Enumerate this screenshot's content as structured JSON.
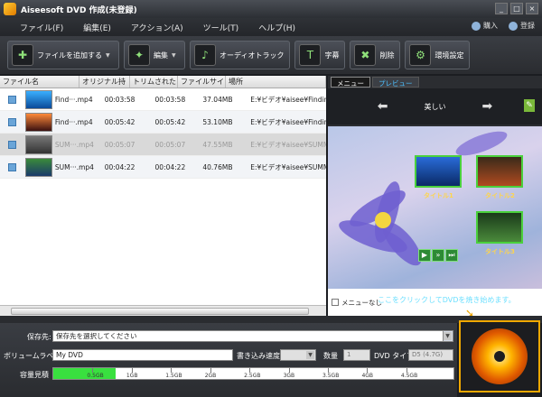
{
  "window": {
    "title": "Aiseesoft DVD 作成(未登録)",
    "buttons": [
      "_",
      "□",
      "×"
    ]
  },
  "menubar": {
    "items": [
      "ファイル(F)",
      "編集(E)",
      "アクション(A)",
      "ツール(T)",
      "ヘルプ(H)"
    ],
    "right": [
      "購入",
      "登録"
    ]
  },
  "toolbar": {
    "buttons": [
      {
        "label": "ファイルを追加する",
        "icon": "add-file-icon"
      },
      {
        "label": "編集",
        "icon": "magic-wand-icon"
      },
      {
        "label": "オーディオトラック",
        "icon": "audio-track-icon"
      },
      {
        "label": "字幕",
        "icon": "subtitle-icon"
      },
      {
        "label": "削除",
        "icon": "delete-icon"
      },
      {
        "label": "環境設定",
        "icon": "gear-icon"
      }
    ]
  },
  "filelist": {
    "columns": [
      "ファイル名",
      "オリジナル持",
      "トリムされた",
      "ファイルサイ",
      "場所"
    ],
    "rows": [
      {
        "name": "Find···.mp4",
        "orig": "00:03:58",
        "trim": "00:03:58",
        "size": "37.04MB",
        "path": "E:¥ビデオ¥aisee¥Finding···",
        "disabled": false
      },
      {
        "name": "Find···.mp4",
        "orig": "00:05:42",
        "trim": "00:05:42",
        "size": "53.10MB",
        "path": "E:¥ビデオ¥aisee¥Finding···",
        "disabled": false
      },
      {
        "name": "SUM···.mp4",
        "orig": "00:05:07",
        "trim": "00:05:07",
        "size": "47.55MB",
        "path": "E:¥ビデオ¥aisee¥SUMM···",
        "disabled": true
      },
      {
        "name": "SUM···.mp4",
        "orig": "00:04:22",
        "trim": "00:04:22",
        "size": "40.76MB",
        "path": "E:¥ビデオ¥aisee¥SUMM···",
        "disabled": false
      }
    ]
  },
  "preview": {
    "tabs": [
      "メニュー",
      "プレビュー"
    ],
    "template_name": "美しい",
    "menu_titles": [
      "タイトル1",
      "タイトル2",
      "タイトル3"
    ],
    "no_menu_label": "メニューなし"
  },
  "settings": {
    "save_label": "保存先:",
    "save_placeholder": "保存先を選択してください",
    "volume_label": "ボリュームラベル",
    "volume_value": "My DVD",
    "speed_label": "書き込み速度",
    "count_label": "数量",
    "count_value": "1",
    "dvd_type_label": "DVD タイプ",
    "dvd_type_value": "D5 (4.7G)",
    "capacity_label": "容量見積",
    "capacity_ticks": [
      "0.5GB",
      "1GB",
      "1.5GB",
      "2GB",
      "2.5GB",
      "3GB",
      "3.5GB",
      "4GB",
      "4.5GB"
    ],
    "capacity_used_fraction": 0.155
  },
  "hint": "ここをクリックしてDVDを焼き始めます。"
}
